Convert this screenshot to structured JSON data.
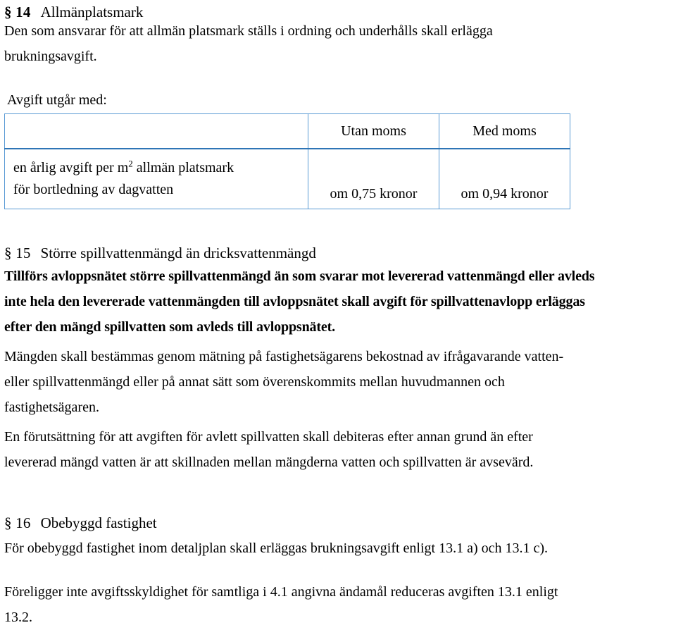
{
  "document": {
    "language": "sv",
    "accent_color": "#5b9bd5",
    "accent_color_strong": "#2e75b6",
    "text_color": "#000000",
    "background": "#ffffff"
  },
  "section_14": {
    "number": "§ 14",
    "title": "Allmänplatsmark",
    "body": "Den som ansvarar för att allmän platsmark ställs i ordning och underhålls skall erlägga brukningsavgift.",
    "body_lines": [
      "Den som ansvarar för att allmän platsmark ställs i ordning och underhålls skall erlägga",
      "brukningsavgift."
    ],
    "lead_in": "Avgift utgår med:"
  },
  "fee_table": {
    "columns": [
      "",
      "Utan moms",
      "Med moms"
    ],
    "rows": [
      {
        "label_lines": [
          "en årlig avgift per m² allmän platsmark",
          "för bortledning av dagvatten"
        ],
        "label_line1_pre": "en årlig avgift per m",
        "label_line1_sup": "2",
        "label_line1_post": " allmän platsmark",
        "label_line2": "för bortledning av dagvatten",
        "utan_moms": "om 0,75 kronor",
        "med_moms": "om 0,94 kronor"
      }
    ]
  },
  "section_15": {
    "number": "§ 15",
    "title": "Större spillvattenmängd än dricksvattenmängd",
    "paragraph_1_lines": [
      "Tillförs avloppsnätet större spillvattenmängd än som svarar mot levererad vattenmängd eller avleds",
      "inte hela den levererade vattenmängden till avloppsnätet skall avgift för spillvattenavlopp erläggas",
      "efter den mängd spillvatten som avleds till avloppsnätet."
    ],
    "paragraph_2_lines": [
      "Mängden skall bestämmas genom mätning på fastighetsägarens bekostnad av ifrågavarande vatten-",
      "eller spillvattenmängd eller på annat sätt som överenskommits mellan huvudmannen och",
      "fastighetsägaren."
    ],
    "paragraph_3_lines": [
      "En förutsättning för att avgiften för avlett spillvatten skall debiteras efter annan grund än efter",
      "levererad mängd vatten är att skillnaden mellan mängderna vatten och spillvatten är avsevärd."
    ]
  },
  "section_16": {
    "number": "§ 16",
    "title": "Obebyggd fastighet",
    "paragraph_1_lines": [
      "För obebyggd fastighet inom detaljplan skall erläggas brukningsavgift enligt 13.1 a) och 13.1 c)."
    ],
    "paragraph_2_lines": [
      "Föreligger inte avgiftsskyldighet för samtliga i 4.1 angivna ändamål reduceras avgiften 13.1 enligt",
      "13.2."
    ]
  }
}
